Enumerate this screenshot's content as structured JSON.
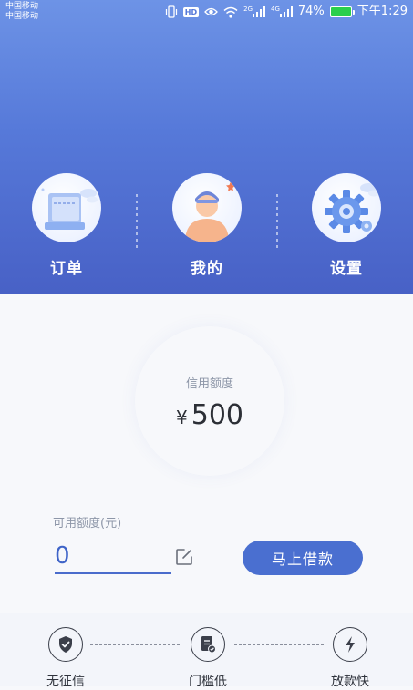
{
  "status_bar": {
    "carrier_1": "中国移动",
    "carrier_2": "中国移动",
    "hd_badge": "HD",
    "net_1": "2G",
    "net_2": "4G",
    "battery_percent": "74%",
    "time": "下午1:29",
    "icons": [
      "vibrate-icon",
      "hd-icon",
      "eye-icon",
      "wifi-icon",
      "signal-icon",
      "battery-icon"
    ]
  },
  "nav": {
    "items": [
      {
        "label": "订单",
        "icon": "order-icon"
      },
      {
        "label": "我的",
        "icon": "profile-icon"
      },
      {
        "label": "设置",
        "icon": "settings-gear-icon"
      }
    ]
  },
  "credit": {
    "label": "信用额度",
    "currency": "¥",
    "amount": "500"
  },
  "available": {
    "label": "可用额度(元)",
    "value": "0"
  },
  "borrow_button": {
    "label": "马上借款"
  },
  "features": [
    {
      "label": "无征信",
      "icon": "shield-check-icon"
    },
    {
      "label": "门槛低",
      "icon": "document-check-icon"
    },
    {
      "label": "放款快",
      "icon": "lightning-icon"
    }
  ],
  "colors": {
    "header_top": "#6d93e6",
    "header_bottom": "#4861c6",
    "accent": "#4a6fd0",
    "page_bg": "#f7f8fb"
  }
}
